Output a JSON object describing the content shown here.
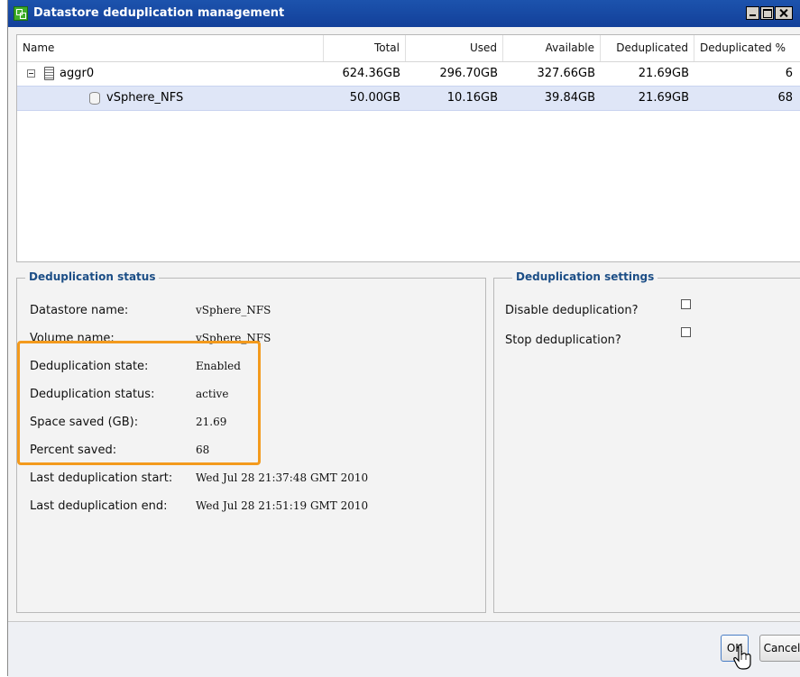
{
  "window": {
    "title": "Datastore deduplication management"
  },
  "grid": {
    "columns": [
      "Name",
      "Total",
      "Used",
      "Available",
      "Deduplicated",
      "Deduplicated %"
    ],
    "rows": [
      {
        "name": "aggr0",
        "total": "624.36GB",
        "used": "296.70GB",
        "available": "327.66GB",
        "deduplicated": "21.69GB",
        "percent": "6"
      },
      {
        "name": "vSphere_NFS",
        "total": "50.00GB",
        "used": "10.16GB",
        "available": "39.84GB",
        "deduplicated": "21.69GB",
        "percent": "68"
      }
    ]
  },
  "status": {
    "legend": "Deduplication status",
    "fields": [
      {
        "label": "Datastore name:",
        "value": "vSphere_NFS"
      },
      {
        "label": "Volume name:",
        "value": "vSphere_NFS"
      },
      {
        "label": "Deduplication state:",
        "value": "Enabled"
      },
      {
        "label": "Deduplication status:",
        "value": "active"
      },
      {
        "label": "Space saved (GB):",
        "value": "21.69"
      },
      {
        "label": "Percent saved:",
        "value": "68"
      },
      {
        "label": "Last deduplication start:",
        "value": "Wed Jul 28 21:37:48 GMT 2010"
      },
      {
        "label": "Last deduplication end:",
        "value": "Wed Jul 28 21:51:19 GMT 2010"
      }
    ]
  },
  "settings": {
    "legend": "Deduplication settings",
    "options": [
      {
        "label": "Disable deduplication?",
        "checked": false
      },
      {
        "label": "Stop deduplication?",
        "checked": false
      }
    ]
  },
  "footer": {
    "ok_label": "OK",
    "cancel_label": "Cancel"
  },
  "colors": {
    "titlebar": "#1c53ad",
    "legend": "#1c4e86",
    "highlight": "#f39a1d",
    "selected_row": "#dfe6f7"
  }
}
